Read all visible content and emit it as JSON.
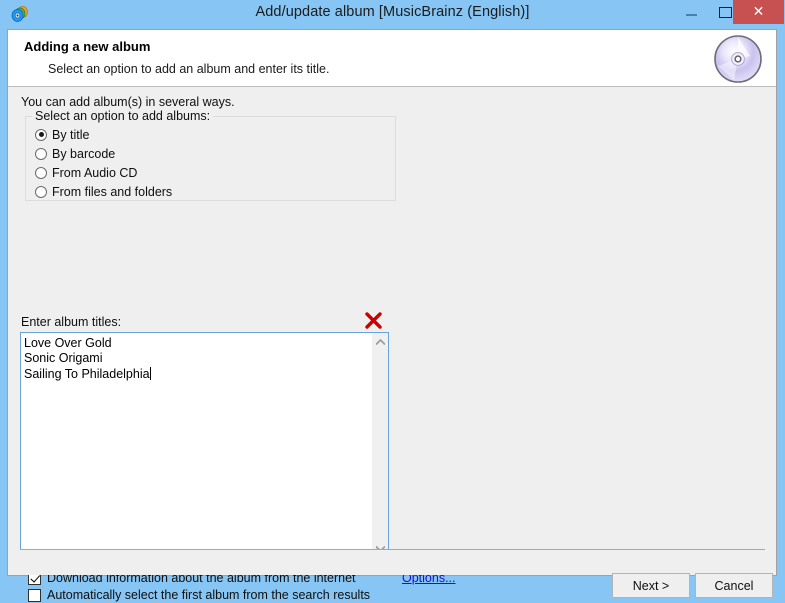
{
  "window": {
    "title": "Add/update album [MusicBrainz (English)]",
    "app_icon": "discs-icon",
    "controls": {
      "minimize": "−",
      "maximize": "▢",
      "close": "✕"
    }
  },
  "header": {
    "title": "Adding a new album",
    "subtitle": "Select an option to add an album and enter its title.",
    "icon": "compact-disc-icon"
  },
  "body": {
    "intro": "You can add album(s) in several ways.",
    "groupbox": {
      "legend": "Select an option to add albums:",
      "options": [
        {
          "label": "By title",
          "selected": true
        },
        {
          "label": "By barcode",
          "selected": false
        },
        {
          "label": "From Audio CD",
          "selected": false
        },
        {
          "label": "From files and folders",
          "selected": false
        }
      ]
    },
    "titles_label": "Enter album titles:",
    "delete_icon": "red-x-icon",
    "album_titles": "Love Over Gold\nSonic Origami\nSailing To Philadelphia",
    "scrollbar": {
      "up_arrow": "▲",
      "down_arrow": "▼"
    },
    "checkboxes": [
      {
        "label": "Download information about the album from the internet",
        "checked": true
      },
      {
        "label": "Automatically select the first album from the search results",
        "checked": false
      }
    ],
    "options_link": "Options..."
  },
  "footer": {
    "next_label": "Next >",
    "cancel_label": "Cancel"
  },
  "colors": {
    "titlebar": "#86c5f4",
    "close_button": "#c75050",
    "dialog_bg": "#efefef",
    "link": "#1414c8",
    "delete_x": "#cc0000",
    "textarea_border": "#6aa3dc"
  }
}
